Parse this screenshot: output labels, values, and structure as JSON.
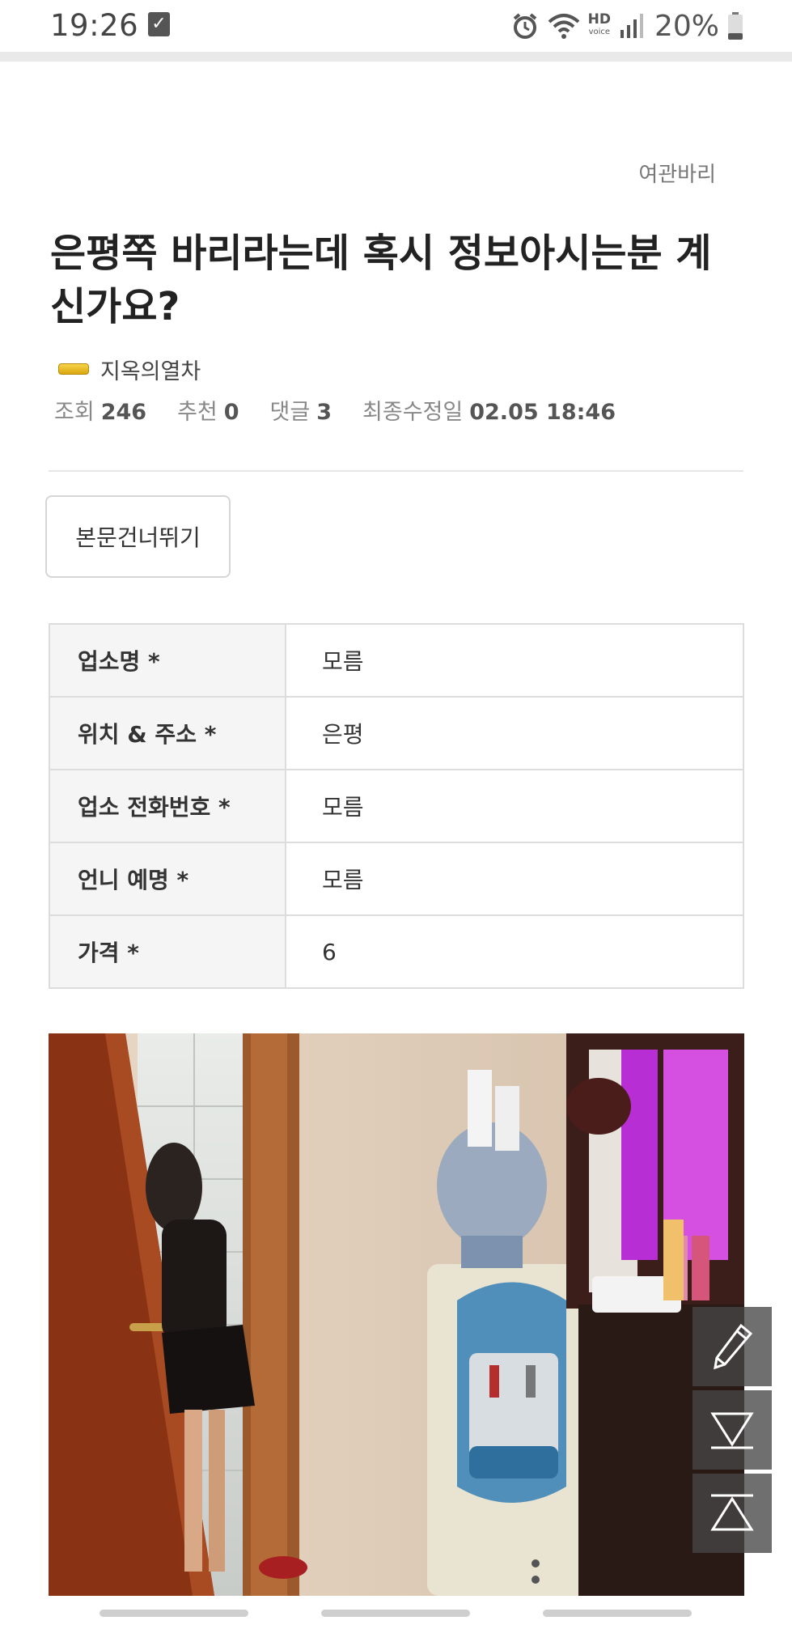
{
  "status_bar": {
    "time": "19:26",
    "check_icon": "checkbox-notification-icon",
    "hd_label": "HD",
    "voice_label": "voice",
    "battery_percent": "20%",
    "icons": [
      "alarm-icon",
      "wifi-icon",
      "hd-voice-icon",
      "signal-icon",
      "battery-icon"
    ]
  },
  "post": {
    "board_name": "여관바리",
    "title": "은평쪽 바리라는데 혹시 정보아시는분 계신가요?",
    "author": "지옥의열차",
    "level_icon": "level-badge-icon",
    "meta": {
      "views_label": "조회",
      "views": "246",
      "recommend_label": "추천",
      "recommend": "0",
      "comments_label": "댓글",
      "comments": "3",
      "modified_label": "최종수정일",
      "modified": "02.05 18:46"
    },
    "skip_button": "본문건너뛰기"
  },
  "info_table": [
    {
      "label": "업소명 *",
      "value": "모름"
    },
    {
      "label": "위치 & 주소 *",
      "value": "은평"
    },
    {
      "label": "업소 전화번호 *",
      "value": "모름"
    },
    {
      "label": "언니 예명 *",
      "value": "모름"
    },
    {
      "label": "가격 *",
      "value": "6"
    }
  ],
  "photo": {
    "description_icon": "room-photo-image"
  },
  "floating_buttons": {
    "edit_icon": "pencil-icon",
    "down_icon": "scroll-bottom-icon",
    "up_icon": "scroll-top-icon"
  },
  "colors": {
    "accent_gold": "#e0b020",
    "fab_bg": "#464646",
    "table_border": "#dcdcdc"
  }
}
